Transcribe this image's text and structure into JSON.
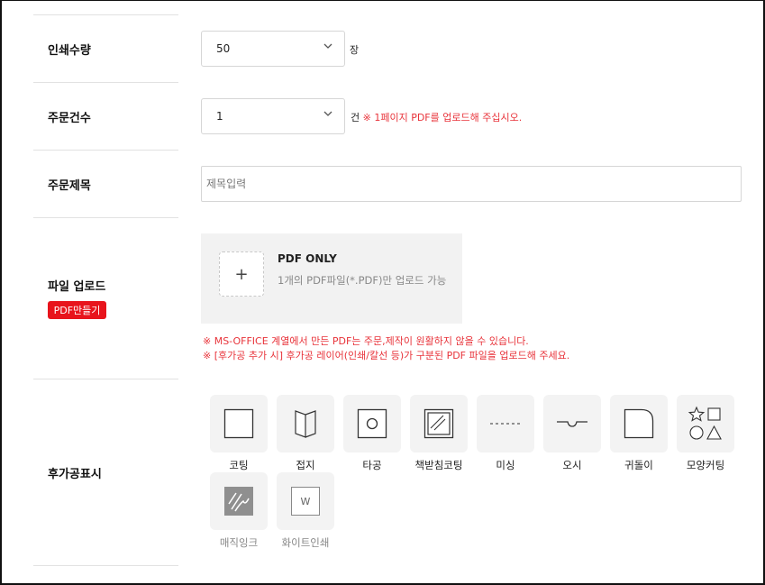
{
  "form": {
    "print_qty": {
      "label": "인쇄수량",
      "value": "50",
      "unit": "장"
    },
    "order_count": {
      "label": "주문건수",
      "value": "1",
      "unit": "건",
      "note": "※ 1페이지 PDF를 업로드해 주십시오."
    },
    "order_title": {
      "label": "주문제목",
      "placeholder": "제목입력"
    },
    "file_upload": {
      "label": "파일 업로드",
      "badge": "PDF만들기",
      "plus": "+",
      "title": "PDF ONLY",
      "desc": "1개의 PDF파일(*.PDF)만 업로드 가능",
      "warnings": [
        "※ MS-OFFICE 계열에서 만든 PDF는 주문,제작이 원활하지 않을 수 있습니다.",
        "※ [후가공 추가 시] 후가공 레이어(인쇄/칼선 등)가 구분된 PDF 파일을 업로드해 주세요."
      ]
    },
    "post_process": {
      "label": "후가공표시",
      "options": [
        {
          "label": "코팅",
          "icon": "square-icon"
        },
        {
          "label": "접지",
          "icon": "fold-icon"
        },
        {
          "label": "타공",
          "icon": "punch-hole-icon"
        },
        {
          "label": "책받침코팅",
          "icon": "laminate-icon"
        },
        {
          "label": "미싱",
          "icon": "perforation-icon"
        },
        {
          "label": "오시",
          "icon": "crease-icon"
        },
        {
          "label": "귀돌이",
          "icon": "rounded-corner-icon"
        },
        {
          "label": "모양커팅",
          "icon": "shape-cut-icon"
        },
        {
          "label": "매직잉크",
          "icon": "magic-ink-icon"
        },
        {
          "label": "화이트인쇄",
          "icon": "white-print-icon",
          "glyph": "W"
        }
      ]
    }
  }
}
